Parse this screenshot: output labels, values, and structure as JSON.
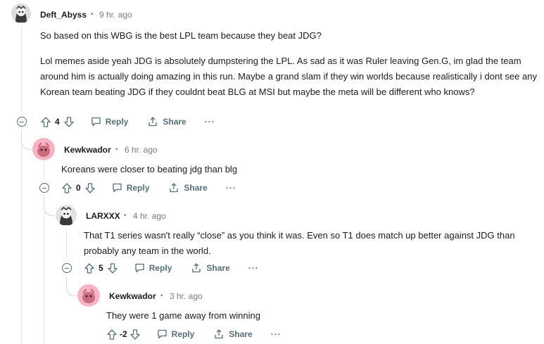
{
  "comments": [
    {
      "username": "Deft_Abyss",
      "separator": "•",
      "timestamp": "9 hr. ago",
      "paragraphs": [
        "So based on this WBG is the best LPL team because they beat JDG?",
        "Lol memes aside yeah JDG is absolutely dumpstering the LPL. As sad as it was Ruler leaving Gen.G, im glad the team around him is actually doing amazing in this run. Maybe a grand slam if they win worlds because realistically i dont see any Korean team beating JDG if they couldnt beat BLG at MSI but maybe the meta will be different who knows?"
      ],
      "votes": "4",
      "reply_label": "Reply",
      "share_label": "Share",
      "more_label": "···"
    },
    {
      "username": "Kewkwador",
      "separator": "•",
      "timestamp": "6 hr. ago",
      "paragraphs": [
        "Koreans were closer to beating jdg than blg"
      ],
      "votes": "0",
      "reply_label": "Reply",
      "share_label": "Share",
      "more_label": "···"
    },
    {
      "username": "LARXXX",
      "separator": "•",
      "timestamp": "4 hr. ago",
      "paragraphs": [
        "That T1 series wasn't really “close” as you think it was. Even so T1 does match up better against JDG than probably any team in the world."
      ],
      "votes": "5",
      "reply_label": "Reply",
      "share_label": "Share",
      "more_label": "···"
    },
    {
      "username": "Kewkwador",
      "separator": "•",
      "timestamp": "3 hr. ago",
      "paragraphs": [
        "They were 1 game away from winning"
      ],
      "votes": "-2",
      "reply_label": "Reply",
      "share_label": "Share",
      "more_label": "···"
    }
  ],
  "colors": {
    "meta_gray": "#7c7c7c",
    "action_gray": "#576f76",
    "thread_line": "#e5e5e5",
    "avatar_pink": "#f4a6b8"
  }
}
